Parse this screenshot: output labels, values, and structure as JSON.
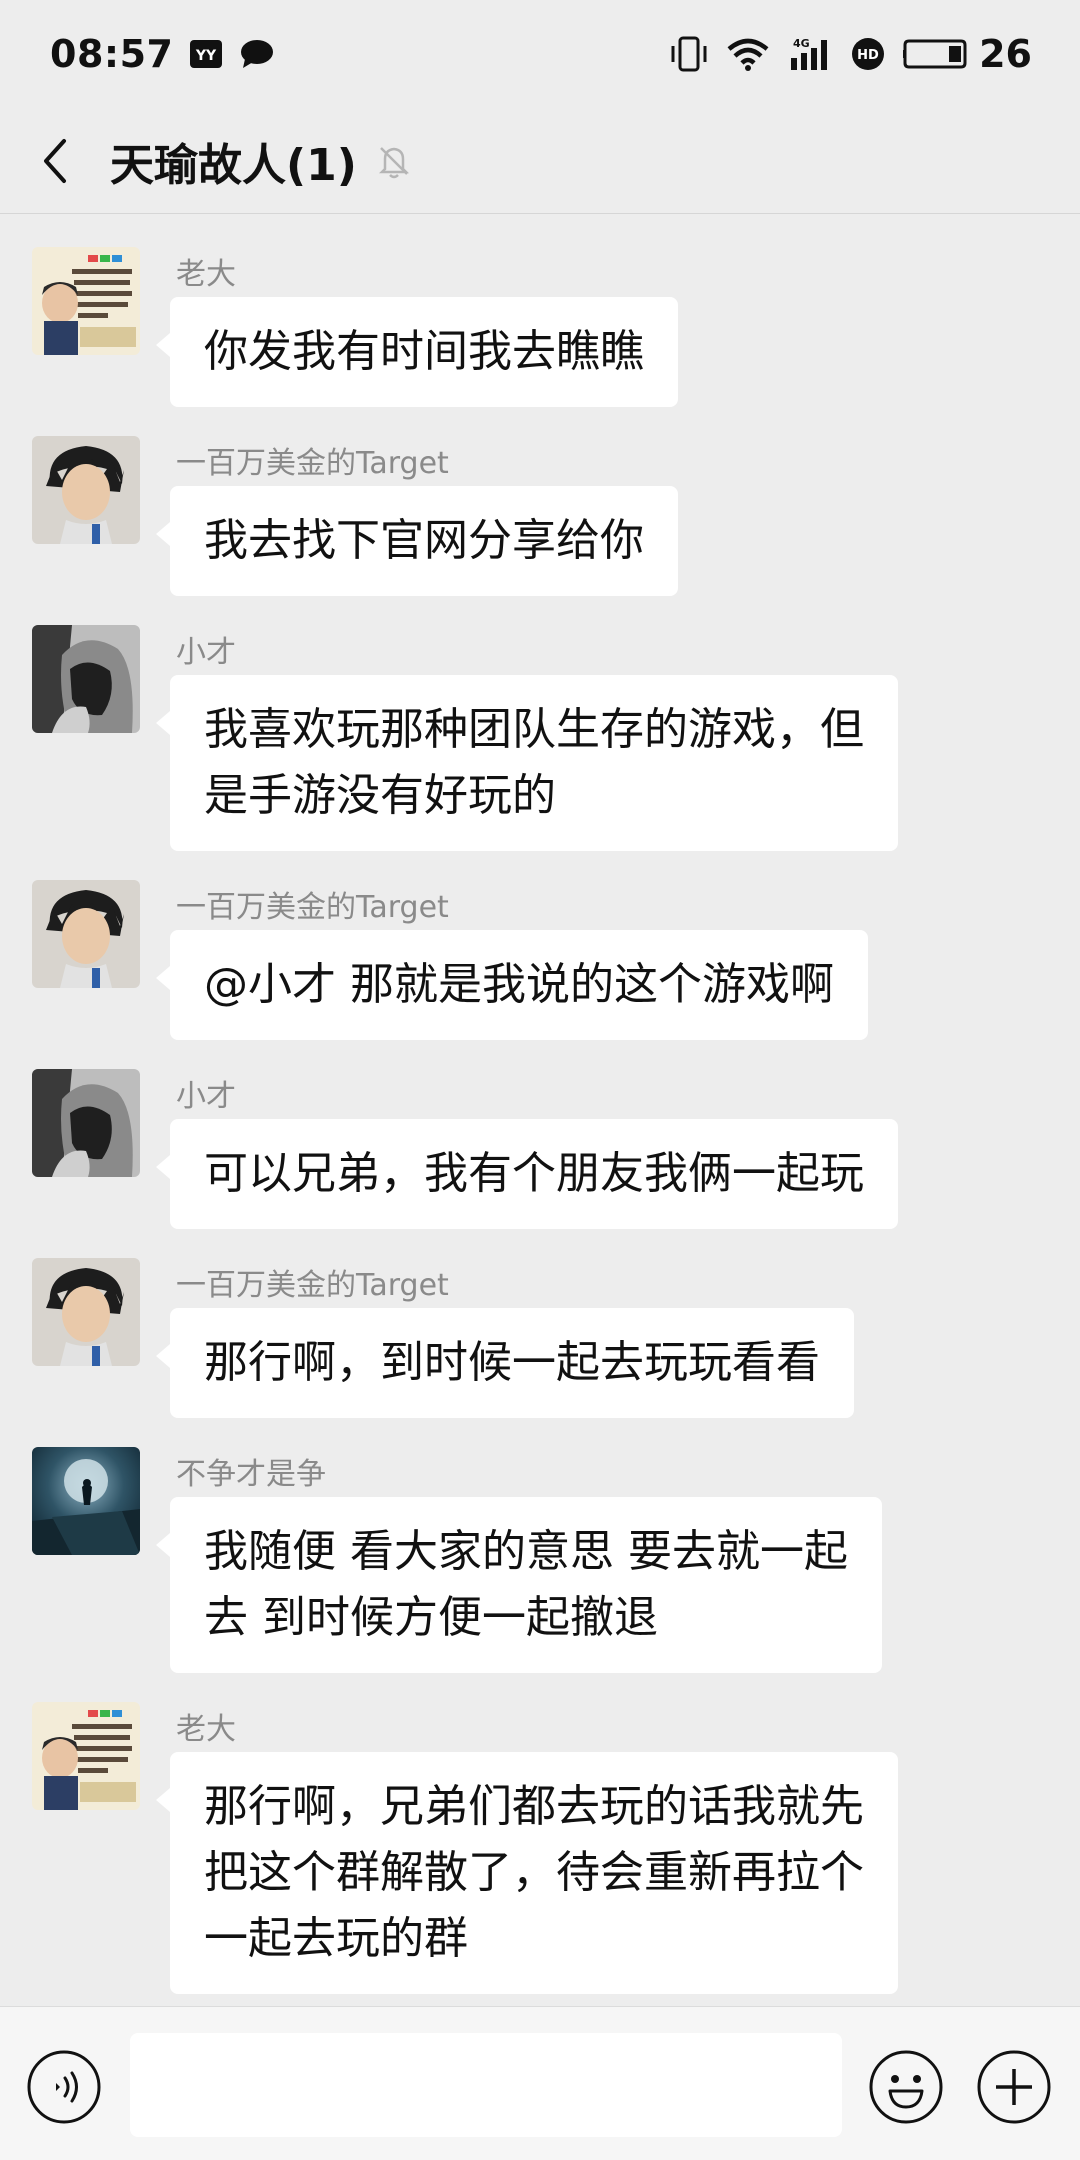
{
  "status": {
    "time": "08:57",
    "battery_level": "26",
    "network": "4G"
  },
  "header": {
    "title": "天瑜故人(1)"
  },
  "messages": [
    {
      "sender": "老大",
      "avatar": "laoda-avatar",
      "lines": [
        "你发我有时间我去瞧瞧"
      ]
    },
    {
      "sender": "一百万美金的Target",
      "avatar": "target-avatar",
      "lines": [
        "我去找下官网分享给你"
      ]
    },
    {
      "sender": "小才",
      "avatar": "xiaocai-avatar",
      "lines": [
        "我喜欢玩那种团队生存的游戏，但",
        "是手游没有好玩的"
      ]
    },
    {
      "sender": "一百万美金的Target",
      "avatar": "target-avatar",
      "lines": [
        "@小才  那就是我说的这个游戏啊"
      ]
    },
    {
      "sender": "小才",
      "avatar": "xiaocai-avatar",
      "lines": [
        "可以兄弟，我有个朋友我俩一起玩"
      ]
    },
    {
      "sender": "一百万美金的Target",
      "avatar": "target-avatar",
      "lines": [
        "那行啊，到时候一起去玩玩看看"
      ]
    },
    {
      "sender": "不争才是争",
      "avatar": "buzheng-avatar",
      "lines": [
        "我随便 看大家的意思 要去就一起",
        "去 到时候方便一起撤退"
      ]
    },
    {
      "sender": "老大",
      "avatar": "laoda-avatar",
      "lines": [
        "那行啊，兄弟们都去玩的话我就先",
        "把这个群解散了，待会重新再拉个",
        "一起去玩的群"
      ]
    }
  ],
  "input": {
    "value": "",
    "placeholder": ""
  },
  "colors": {
    "background": "#ededed",
    "bubble": "#ffffff",
    "sender_name": "#8a8a8a"
  },
  "icons": [
    "back-arrow-icon",
    "mute-bell-icon",
    "voice-icon",
    "emoji-icon",
    "plus-icon",
    "vibrate-icon",
    "wifi-icon",
    "signal-icon",
    "hd-icon",
    "battery-icon"
  ]
}
